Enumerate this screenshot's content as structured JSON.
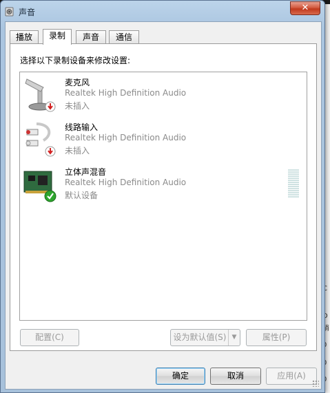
{
  "window": {
    "title": "声音",
    "close_glyph": "✕"
  },
  "tabs": [
    {
      "label": "播放",
      "active": false
    },
    {
      "label": "录制",
      "active": true
    },
    {
      "label": "声音",
      "active": false
    },
    {
      "label": "通信",
      "active": false
    }
  ],
  "recording": {
    "instruction": "选择以下录制设备来修改设置:",
    "devices": [
      {
        "name": "麦克风",
        "driver": "Realtek High Definition Audio",
        "status": "未插入",
        "icon": "microphone-icon",
        "badge": "unplugged-badge-icon"
      },
      {
        "name": "线路输入",
        "driver": "Realtek High Definition Audio",
        "status": "未插入",
        "icon": "line-in-cable-icon",
        "badge": "unplugged-badge-icon"
      },
      {
        "name": "立体声混音",
        "driver": "Realtek High Definition Audio",
        "status": "默认设备",
        "icon": "sound-card-icon",
        "badge": "default-checkmark-icon",
        "level": 0
      }
    ]
  },
  "buttons": {
    "configure": "配置(C)",
    "set_default": "设为默认值(S)",
    "properties": "属性(P)",
    "ok": "确定",
    "cancel": "取消",
    "apply": "应用(A)"
  },
  "background_right_chars": [
    "(",
    "C",
    "(",
    "D",
    "硝",
    "0",
    "0",
    "0"
  ],
  "colors": {
    "accent": "#3c7fb1",
    "close": "#c0391d",
    "check": "#2ea62e",
    "unplugged": "#d22020"
  }
}
